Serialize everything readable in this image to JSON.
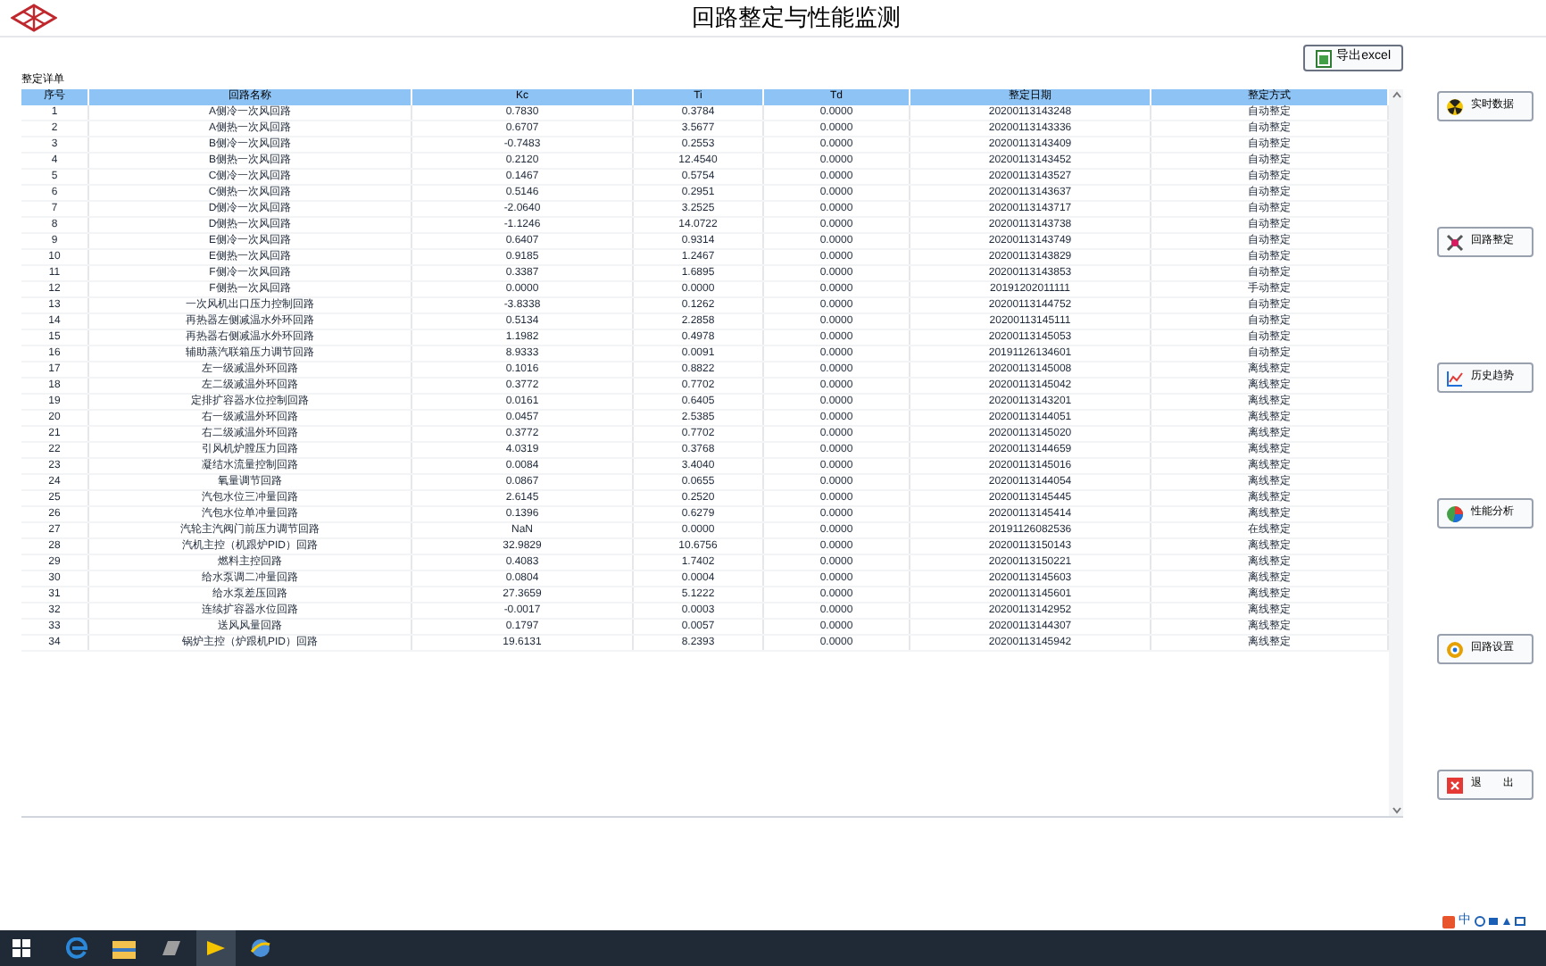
{
  "window": {
    "title": "回路整定与性能监测"
  },
  "export_button": {
    "label": "导出excel"
  },
  "table": {
    "caption": "整定详单",
    "columns": [
      "序号",
      "回路名称",
      "Kc",
      "Ti",
      "Td",
      "整定日期",
      "整定方式"
    ],
    "rows": [
      [
        "1",
        "A侧冷一次风回路",
        "0.7830",
        "0.3784",
        "0.0000",
        "20200113143248",
        "自动整定"
      ],
      [
        "2",
        "A侧热一次风回路",
        "0.6707",
        "3.5677",
        "0.0000",
        "20200113143336",
        "自动整定"
      ],
      [
        "3",
        "B侧冷一次风回路",
        "-0.7483",
        "0.2553",
        "0.0000",
        "20200113143409",
        "自动整定"
      ],
      [
        "4",
        "B侧热一次风回路",
        "0.2120",
        "12.4540",
        "0.0000",
        "20200113143452",
        "自动整定"
      ],
      [
        "5",
        "C侧冷一次风回路",
        "0.1467",
        "0.5754",
        "0.0000",
        "20200113143527",
        "自动整定"
      ],
      [
        "6",
        "C侧热一次风回路",
        "0.5146",
        "0.2951",
        "0.0000",
        "20200113143637",
        "自动整定"
      ],
      [
        "7",
        "D侧冷一次风回路",
        "-2.0640",
        "3.2525",
        "0.0000",
        "20200113143717",
        "自动整定"
      ],
      [
        "8",
        "D侧热一次风回路",
        "-1.1246",
        "14.0722",
        "0.0000",
        "20200113143738",
        "自动整定"
      ],
      [
        "9",
        "E侧冷一次风回路",
        "0.6407",
        "0.9314",
        "0.0000",
        "20200113143749",
        "自动整定"
      ],
      [
        "10",
        "E侧热一次风回路",
        "0.9185",
        "1.2467",
        "0.0000",
        "20200113143829",
        "自动整定"
      ],
      [
        "11",
        "F侧冷一次风回路",
        "0.3387",
        "1.6895",
        "0.0000",
        "20200113143853",
        "自动整定"
      ],
      [
        "12",
        "F侧热一次风回路",
        "0.0000",
        "0.0000",
        "0.0000",
        "20191202011111",
        "手动整定"
      ],
      [
        "13",
        "一次风机出口压力控制回路",
        "-3.8338",
        "0.1262",
        "0.0000",
        "20200113144752",
        "自动整定"
      ],
      [
        "14",
        "再热器左侧减温水外环回路",
        "0.5134",
        "2.2858",
        "0.0000",
        "20200113145111",
        "自动整定"
      ],
      [
        "15",
        "再热器右侧减温水外环回路",
        "1.1982",
        "0.4978",
        "0.0000",
        "20200113145053",
        "自动整定"
      ],
      [
        "16",
        "辅助蒸汽联箱压力调节回路",
        "8.9333",
        "0.0091",
        "0.0000",
        "20191126134601",
        "自动整定"
      ],
      [
        "17",
        "左一级减温外环回路",
        "0.1016",
        "0.8822",
        "0.0000",
        "20200113145008",
        "离线整定"
      ],
      [
        "18",
        "左二级减温外环回路",
        "0.3772",
        "0.7702",
        "0.0000",
        "20200113145042",
        "离线整定"
      ],
      [
        "19",
        "定排扩容器水位控制回路",
        "0.0161",
        "0.6405",
        "0.0000",
        "20200113143201",
        "离线整定"
      ],
      [
        "20",
        "右一级减温外环回路",
        "0.0457",
        "2.5385",
        "0.0000",
        "20200113144051",
        "离线整定"
      ],
      [
        "21",
        "右二级减温外环回路",
        "0.3772",
        "0.7702",
        "0.0000",
        "20200113145020",
        "离线整定"
      ],
      [
        "22",
        "引风机炉膛压力回路",
        "4.0319",
        "0.3768",
        "0.0000",
        "20200113144659",
        "离线整定"
      ],
      [
        "23",
        "凝结水流量控制回路",
        "0.0084",
        "3.4040",
        "0.0000",
        "20200113145016",
        "离线整定"
      ],
      [
        "24",
        "氧量调节回路",
        "0.0867",
        "0.0655",
        "0.0000",
        "20200113144054",
        "离线整定"
      ],
      [
        "25",
        "汽包水位三冲量回路",
        "2.6145",
        "0.2520",
        "0.0000",
        "20200113145445",
        "离线整定"
      ],
      [
        "26",
        "汽包水位单冲量回路",
        "0.1396",
        "0.6279",
        "0.0000",
        "20200113145414",
        "离线整定"
      ],
      [
        "27",
        "汽轮主汽阀门前压力调节回路",
        "NaN",
        "0.0000",
        "0.0000",
        "20191126082536",
        "在线整定"
      ],
      [
        "28",
        "汽机主控（机跟炉PID）回路",
        "32.9829",
        "10.6756",
        "0.0000",
        "20200113150143",
        "离线整定"
      ],
      [
        "29",
        "燃料主控回路",
        "0.4083",
        "1.7402",
        "0.0000",
        "20200113150221",
        "离线整定"
      ],
      [
        "30",
        "给水泵调二冲量回路",
        "0.0804",
        "0.0004",
        "0.0000",
        "20200113145603",
        "离线整定"
      ],
      [
        "31",
        "给水泵差压回路",
        "27.3659",
        "5.1222",
        "0.0000",
        "20200113145601",
        "离线整定"
      ],
      [
        "32",
        "连续扩容器水位回路",
        "-0.0017",
        "0.0003",
        "0.0000",
        "20200113142952",
        "离线整定"
      ],
      [
        "33",
        "送风风量回路",
        "0.1797",
        "0.0057",
        "0.0000",
        "20200113144307",
        "离线整定"
      ],
      [
        "34",
        "锅炉主控（炉跟机PID）回路",
        "19.6131",
        "8.2393",
        "0.0000",
        "20200113145942",
        "离线整定"
      ]
    ]
  },
  "side_buttons": [
    {
      "kind": "radiation",
      "label": "实时数据"
    },
    {
      "kind": "tools",
      "label": "回路整定"
    },
    {
      "kind": "trend",
      "label": "历史趋势"
    },
    {
      "kind": "pie",
      "label": "性能分析"
    },
    {
      "kind": "gear",
      "label": "回路设置"
    },
    {
      "kind": "close",
      "label": "退　　出"
    }
  ],
  "ime_bar": {
    "label": "中"
  }
}
